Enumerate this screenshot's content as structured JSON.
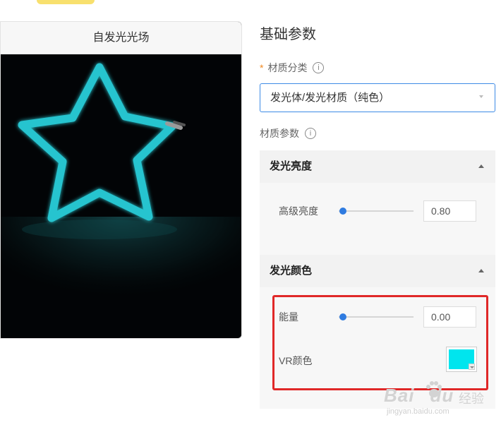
{
  "preview": {
    "title": "自发光光场"
  },
  "panel": {
    "title": "基础参数",
    "material_category": {
      "label": "材质分类",
      "required_mark": "*",
      "info_icon": "info-icon",
      "selected": "发光体/发光材质（纯色）"
    },
    "material_params_label": "材质参数",
    "sections": [
      {
        "title": "发光亮度",
        "rows": [
          {
            "label": "高级亮度",
            "value": "0.80",
            "slider_fraction": 0.0
          }
        ]
      },
      {
        "title": "发光颜色",
        "rows": [
          {
            "label": "能量",
            "value": "0.00",
            "slider_fraction": 0.0
          },
          {
            "label": "VR颜色",
            "color": "#00e5ee"
          }
        ]
      }
    ]
  },
  "colors": {
    "accent": "#3d8ae6",
    "neon": "#27c4cf",
    "highlight": "#e02828",
    "required": "#f08a24"
  },
  "watermark": {
    "brand": "Bai",
    "brand2": "du",
    "cn": "经验",
    "url": "jingyan.baidu.com"
  }
}
